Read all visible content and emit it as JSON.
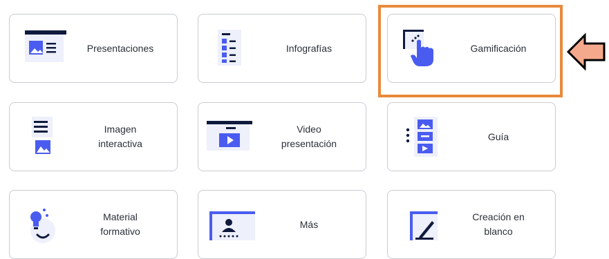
{
  "colors": {
    "accent": "#4a5cf0",
    "dark": "#0f1b3d",
    "highlight": "#e88a3c",
    "arrow_fill": "#f4a98d"
  },
  "options": [
    {
      "label": "Presentaciones",
      "icon": "presentation-icon"
    },
    {
      "label": "Infografías",
      "icon": "infographic-icon"
    },
    {
      "label": "Gamificación",
      "icon": "gamification-icon"
    },
    {
      "label": "Imagen\ninteractiva",
      "icon": "interactive-image-icon"
    },
    {
      "label": "Video\npresentación",
      "icon": "video-presentation-icon"
    },
    {
      "label": "Guía",
      "icon": "guide-icon"
    },
    {
      "label": "Material\nformativo",
      "icon": "training-material-icon"
    },
    {
      "label": "Más",
      "icon": "more-icon"
    },
    {
      "label": "Creación en\nblanco",
      "icon": "blank-creation-icon"
    }
  ],
  "selected_option": "Gamificación"
}
